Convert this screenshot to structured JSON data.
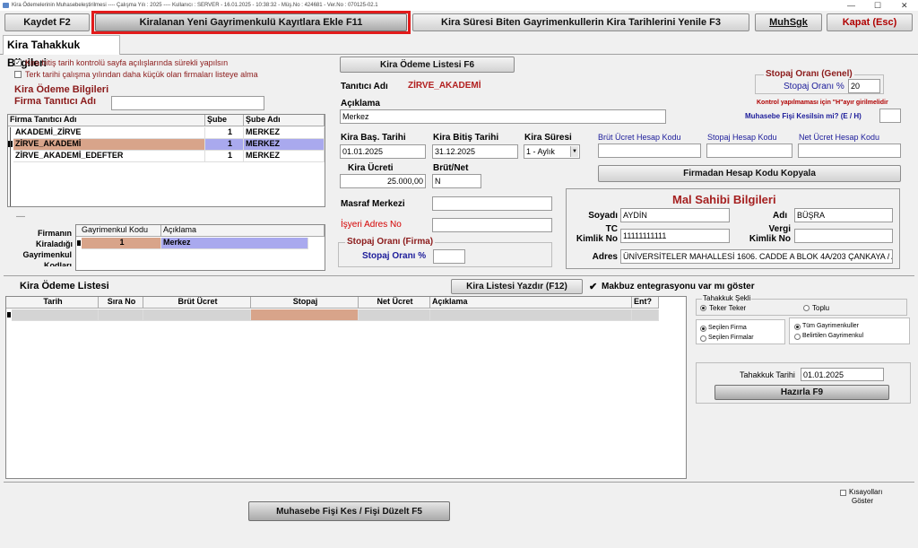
{
  "window": {
    "title": "Kira Ödemelerinin Muhasebeleştirilmesi  ----  Çalışma Yılı : 2025  ----  Kullanıcı : SERVER - 16.01.2025 - 10:38:32  -  Müş.No : 424681 - Ver.No : 070125-02.1",
    "minimize": "—",
    "maximize": "☐",
    "close": "✕"
  },
  "toolbar": {
    "save": "Kaydet F2",
    "add_new": "Kiralanan Yeni Gayrimenkulü Kayıtlara Ekle F11",
    "renew": "Kira Süresi Biten Gayrimenkullerin Kira Tarihlerini Yenile F3",
    "muhsgk": "MuhSgk",
    "close": "Kapat (Esc)",
    "highlight_color": "#e21b1b"
  },
  "tab": {
    "label": "Kira Tahakkuk Bilgileri"
  },
  "options": {
    "check1": {
      "checked": true,
      "label": "Kira bitiş tarih kontrolü sayfa açılışlarında sürekli yapılsın"
    },
    "check2": {
      "checked": false,
      "label": "Terk tarihi çalışma yılından daha küçük olan firmaları listeye alma"
    }
  },
  "kira_odeme": {
    "heading": "Kira Ödeme Bilgileri",
    "firma_label": "Firma Tanıtıcı Adı",
    "firma_value": "",
    "columns": [
      "Firma Tanıtıcı Adı",
      "Şube",
      "Şube Adı"
    ],
    "rows": [
      {
        "name": "AKADEMİ_ZİRVE",
        "sube": "1",
        "sube_adi": "MERKEZ"
      },
      {
        "name": "ZİRVE_AKADEMİ",
        "sube": "1",
        "sube_adi": "MERKEZ"
      },
      {
        "name": "ZİRVE_AKADEMİ_EDEFTER",
        "sube": "1",
        "sube_adi": "MERKEZ"
      }
    ],
    "dash": "—"
  },
  "gayrimenkul": {
    "label_lines": [
      "Firmanın",
      "Kiraladığı",
      "Gayrimenkul",
      "Kodları"
    ],
    "columns": [
      "Gayrimenkul Kodu",
      "Açıklama"
    ],
    "rows": [
      {
        "kod": "1",
        "aciklama": "Merkez"
      }
    ]
  },
  "form": {
    "list_button": "Kira Ödeme Listesi F6",
    "tanitici_label": "Tanıtıcı Adı",
    "tanitici_value": "ZİRVE_AKADEMİ",
    "aciklama_label": "Açıklama",
    "aciklama_value": "Merkez",
    "bas_label": "Kira Baş. Tarihi",
    "bas_value": "01.01.2025",
    "bitis_label": "Kira Bitiş Tarihi",
    "bitis_value": "31.12.2025",
    "sure_label": "Kira Süresi",
    "sure_value": "1 - Aylık",
    "ucret_label": "Kira Ücreti",
    "ucret_value": "25.000,00",
    "brutnet_label": "Brüt/Net",
    "brutnet_value": "N",
    "masraf_label": "Masraf Merkezi",
    "masraf_value": "",
    "isyeri_label": "İşyeri Adres No",
    "isyeri_value": "",
    "stopaj_firma_title": "Stopaj Oranı (Firma)",
    "stopaj_firma_label": "Stopaj Oranı %",
    "stopaj_firma_value": ""
  },
  "stopaj_genel": {
    "title": "Stopaj Oranı (Genel)",
    "label": "Stopaj Oranı %",
    "value": "20",
    "warning": "Kontrol yapılmaması için \"H\"ayır girilmelidir",
    "fis_label": "Muhasebe Fişi Kesilsin mi? (E / H)",
    "fis_value": ""
  },
  "hesap_kodlari": {
    "brut_label": "Brüt Ücret Hesap Kodu",
    "brut_value": "",
    "stopaj_label": "Stopaj Hesap Kodu",
    "stopaj_value": "",
    "net_label": "Net Ücret Hesap Kodu",
    "net_value": "",
    "copy_button": "Firmadan Hesap Kodu Kopyala"
  },
  "mal_sahibi": {
    "title": "Mal Sahibi Bilgileri",
    "soyadi_label": "Soyadı",
    "soyadi_value": "AYDİN",
    "adi_label": "Adı",
    "adi_value": "BÜŞRA",
    "tc_label_1": "TC",
    "tc_label_2": "Kimlik No",
    "tc_value": "11111111111",
    "vergi_label_1": "Vergi",
    "vergi_label_2": "Kimlik No",
    "vergi_value": "",
    "adres_label": "Adres",
    "adres_value": "ÜNİVERSİTELER MAHALLESİ 1606. CADDE A BLOK 4A/203 ÇANKAYA / ANKARA"
  },
  "kira_listesi": {
    "title": "Kira Ödeme Listesi",
    "print_button": "Kira Listesi Yazdır (F12)",
    "makbuz_checked": true,
    "makbuz_label": "Makbuz entegrasyonu var mı göster",
    "columns": [
      "Tarih",
      "Sıra No",
      "Brüt Ücret",
      "Stopaj",
      "Net Ücret",
      "Açıklama",
      "Ent?"
    ]
  },
  "tahakkuk": {
    "sekli_title": "Tahakkuk Şekli",
    "teker": "Teker Teker",
    "toplu": "Toplu",
    "secilen_firma": "Seçilen Firma",
    "secilen_firmalar": "Seçilen Firmalar",
    "tum": "Tüm Gayrimenkuller",
    "belirtilen": "Belirtilen Gayrimenkul",
    "tarih_label": "Tahakkuk Tarihi",
    "tarih_value": "01.01.2025",
    "hazirla_button": "Hazırla F9"
  },
  "footer": {
    "fis_button": "Muhasebe Fişi Kes / Fişi Düzelt F5",
    "shortcuts_label_1": "Kısayolları",
    "shortcuts_label_2": "Göster"
  }
}
